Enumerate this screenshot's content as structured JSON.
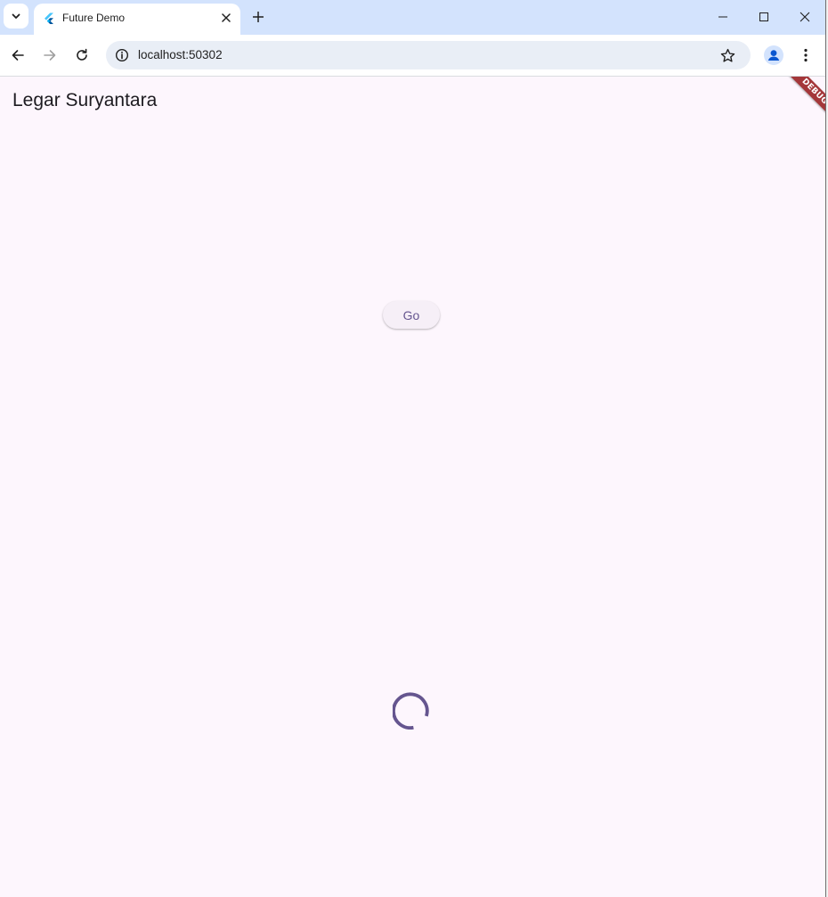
{
  "browser": {
    "tab": {
      "title": "Future Demo"
    },
    "address_bar": {
      "url": "localhost:50302"
    }
  },
  "page": {
    "app_title": "Legar Suryantara",
    "go_button_label": "Go",
    "debug_banner": "DEBUG"
  },
  "colors": {
    "tabstrip_bg": "#d3e3fd",
    "page_bg": "#fdf6fd",
    "primary": "#65558f",
    "debug_banner": "#a4373a"
  }
}
